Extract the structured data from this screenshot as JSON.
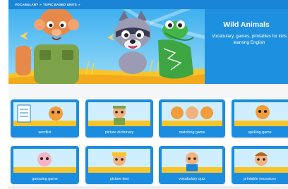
{
  "breadcrumb": {
    "items": [
      "VOCABULARY",
      "TOPIC BASED UNITS"
    ],
    "separator": "»",
    "trailing": "»"
  },
  "hero": {
    "title": "Wild Animals",
    "subtitle": "Vocabulary, games, printables for kids learning English"
  },
  "activities": [
    {
      "label": "wordlist"
    },
    {
      "label": "picture dictionary"
    },
    {
      "label": "matching game"
    },
    {
      "label": "spelling game"
    },
    {
      "label": "guessing game"
    },
    {
      "label": "picture test"
    },
    {
      "label": "vocabulary quiz"
    },
    {
      "label": "printable resources"
    }
  ],
  "colors": {
    "brand_blue": "#1a84d6",
    "tile_blue": "#1b8de1",
    "grass_yellow": "#f7c52a"
  }
}
